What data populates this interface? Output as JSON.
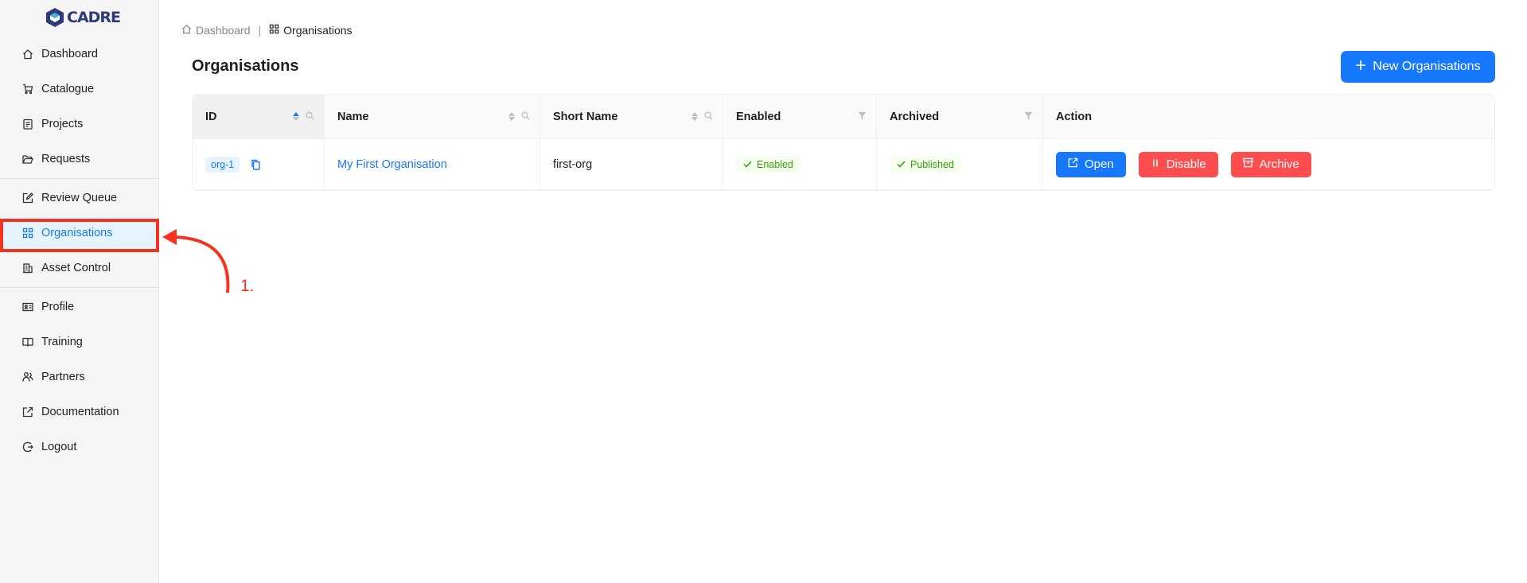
{
  "app": {
    "logo_text": "CADRE"
  },
  "sidebar": {
    "groups": [
      [
        {
          "label": "Dashboard",
          "icon": "home-icon"
        },
        {
          "label": "Catalogue",
          "icon": "cart-icon"
        },
        {
          "label": "Projects",
          "icon": "clipboard-icon"
        },
        {
          "label": "Requests",
          "icon": "folder-open-icon"
        }
      ],
      [
        {
          "label": "Review Queue",
          "icon": "edit-icon"
        },
        {
          "label": "Organisations",
          "icon": "grid-icon",
          "active": true
        },
        {
          "label": "Asset Control",
          "icon": "building-icon"
        }
      ],
      [
        {
          "label": "Profile",
          "icon": "id-card-icon"
        },
        {
          "label": "Training",
          "icon": "book-icon"
        },
        {
          "label": "Partners",
          "icon": "team-icon"
        },
        {
          "label": "Documentation",
          "icon": "external-link-icon"
        },
        {
          "label": "Logout",
          "icon": "logout-icon"
        }
      ]
    ]
  },
  "annotation": {
    "label": "1.",
    "color": "#f5321e"
  },
  "breadcrumb": {
    "home": "Dashboard",
    "separator": "|",
    "current": "Organisations"
  },
  "page": {
    "title": "Organisations",
    "new_button": "New Organisations"
  },
  "table": {
    "columns": [
      "ID",
      "Name",
      "Short Name",
      "Enabled",
      "Archived",
      "Action"
    ],
    "rows": [
      {
        "id": "org-1",
        "name": "My First Organisation",
        "short_name": "first-org",
        "enabled": "Enabled",
        "archived": "Published",
        "actions": {
          "open": "Open",
          "disable": "Disable",
          "archive": "Archive"
        }
      }
    ]
  },
  "colors": {
    "primary": "#1677ff",
    "danger": "#ff4d4f",
    "success": "#389e0d",
    "annotation": "#f5321e"
  }
}
